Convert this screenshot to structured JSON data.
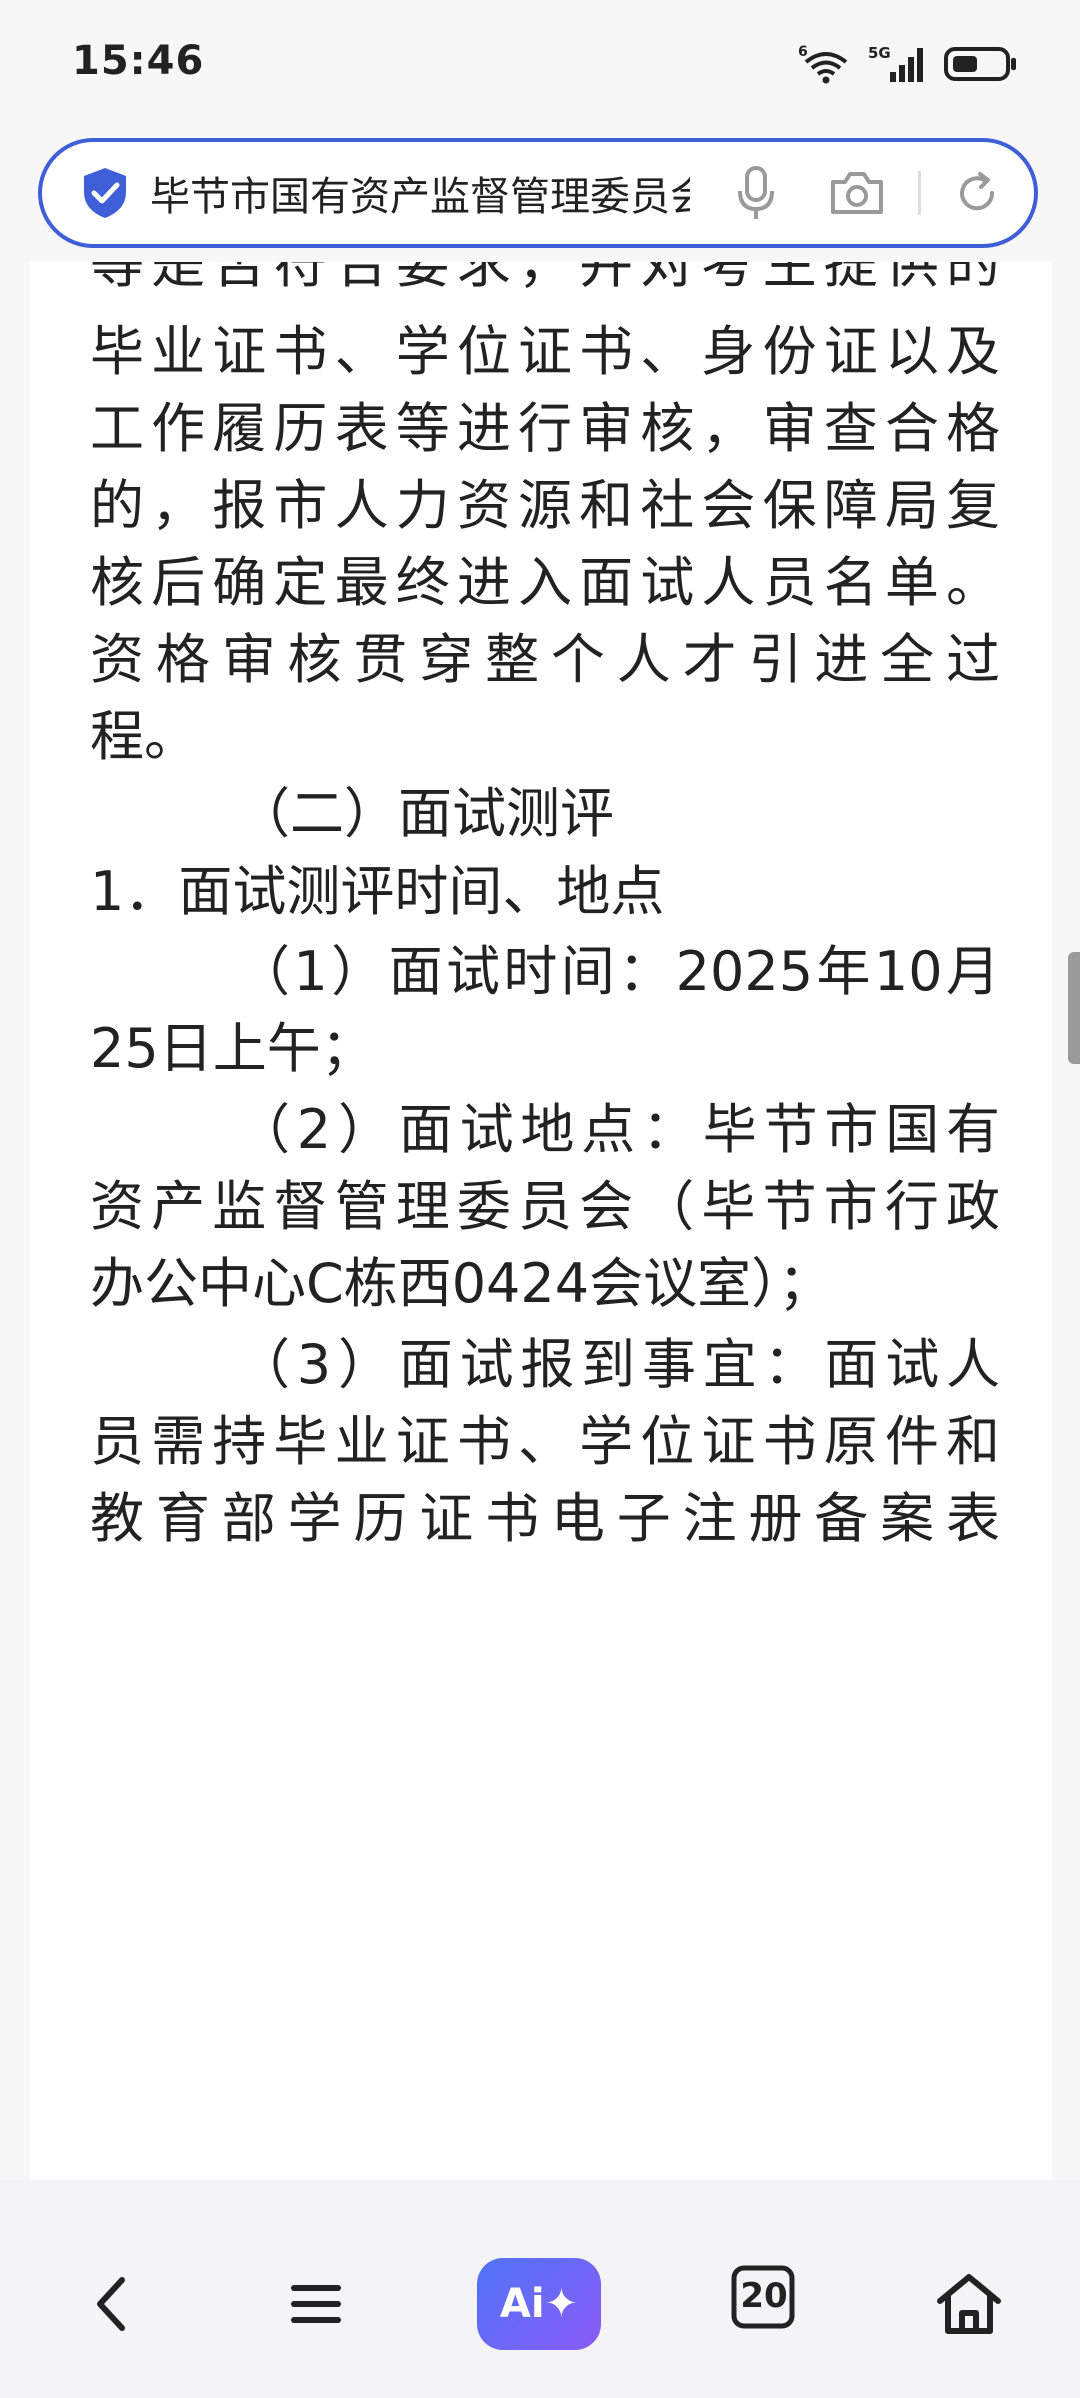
{
  "status_bar": {
    "time": "15:46",
    "network_label": "5G",
    "wifi_badge": "6"
  },
  "address_bar": {
    "url_text": "毕节市国有资产监督管理委员会"
  },
  "article": {
    "partial_top_line": "等是否符合要求，并对考生提供的",
    "lines": [
      "毕业证书、学位证书、身份证以及",
      "工作履历表等进行审核，审查合格",
      "的，报市人力资源和社会保障局复",
      "核后确定最终进入面试人员名单。",
      "资格审核贯穿整个人才引进全过",
      "程。",
      "（二）面试测评",
      "1．面试测评时间、地点",
      "（1）面试时间：2025年10月",
      "25日上午；",
      "（2）面试地点：毕节市国有",
      "资产监督管理委员会（毕节市行政",
      "办公中心C栋西0424会议室）；",
      "（3）面试报到事宜：面试人",
      "员需持毕业证书、学位证书原件和",
      "教育部学历证书电子注册备案表"
    ]
  },
  "bottom_nav": {
    "ai_label": "Ai✦",
    "tab_count": "20"
  },
  "colors": {
    "accent": "#3f5fd8",
    "ai_gradient_start": "#4f74f5",
    "ai_gradient_end": "#8b5cf6"
  }
}
